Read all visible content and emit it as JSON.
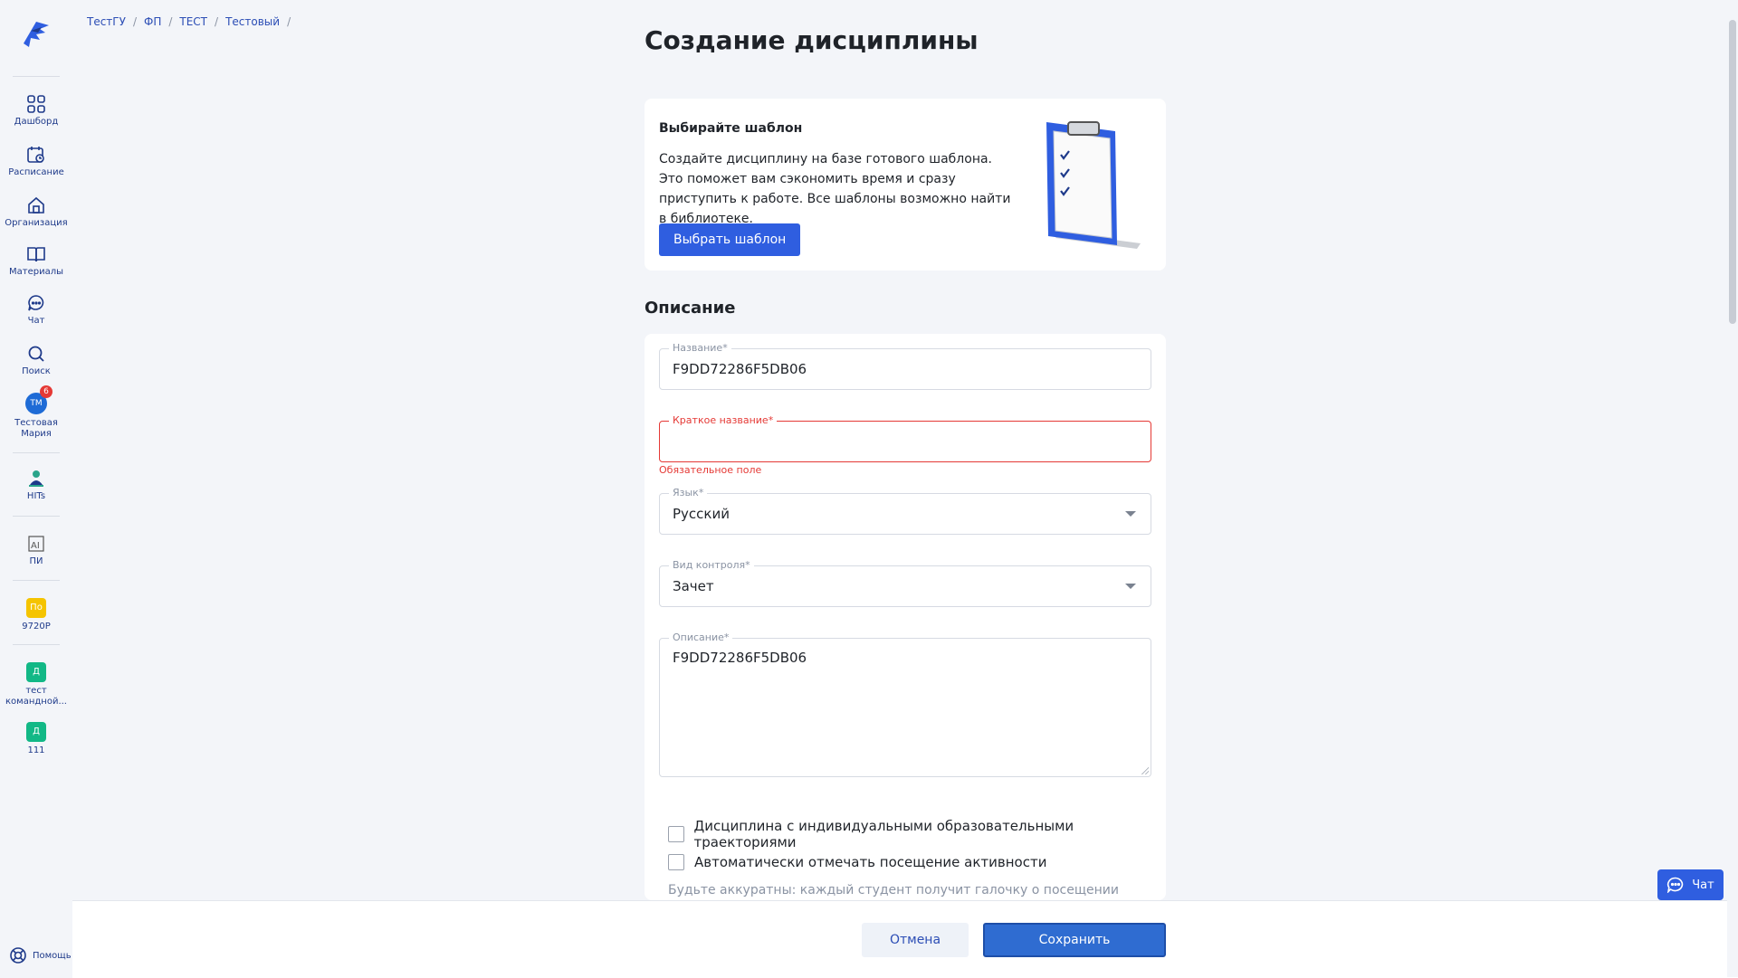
{
  "breadcrumb": [
    "ТестГУ",
    "ФП",
    "ТЕСТ",
    "Тестовый"
  ],
  "page_title": "Создание дисциплины",
  "sidebar": {
    "items": [
      {
        "label": "Дашборд",
        "icon": "dashboard-icon"
      },
      {
        "label": "Расписание",
        "icon": "calendar-icon"
      },
      {
        "label": "Организация",
        "icon": "home-icon"
      },
      {
        "label": "Материалы",
        "icon": "book-icon"
      },
      {
        "label": "Чат",
        "icon": "chat-icon"
      },
      {
        "label": "Поиск",
        "icon": "search-icon"
      }
    ],
    "user": {
      "initials": "ТМ",
      "name": "Тестовая Мария",
      "badge": "6"
    },
    "apps": [
      {
        "label": "HITs"
      },
      {
        "label": "ПИ"
      },
      {
        "label": "9720Р",
        "badge": "По",
        "color": "#f5c400"
      },
      {
        "label": "тест командной...",
        "badge": "Д",
        "color": "#12b886"
      },
      {
        "label": "111",
        "badge": "Д",
        "color": "#12b886"
      }
    ],
    "help": "Помощь"
  },
  "template_card": {
    "title": "Выбирайте шаблон",
    "text": "Создайте дисциплину на базе готового шаблона. Это поможет вам сэкономить время и сразу приступить к работе. Все шаблоны возможно найти в библиотеке.",
    "button": "Выбрать шаблон"
  },
  "description_section": {
    "title": "Описание",
    "name_label": "Название*",
    "name_value": "F9DD72286F5DB06",
    "short_label": "Краткое название*",
    "short_value": "",
    "short_error": "Обязательное поле",
    "lang_label": "Язык*",
    "lang_value": "Русский",
    "control_label": "Вид контроля*",
    "control_value": "Зачет",
    "desc_label": "Описание*",
    "desc_value": "F9DD72286F5DB06",
    "check_individual": "Дисциплина с индивидуальными образовательными траекториями",
    "check_attendance": "Автоматически отмечать посещение активности",
    "hint": "Будьте аккуратны: каждый студент получит галочку о посещении"
  },
  "footer": {
    "cancel": "Отмена",
    "save": "Сохранить"
  },
  "chat_button": "Чат",
  "colors": {
    "primary": "#2f5ee0",
    "error": "#e53935",
    "link": "#2b4db5"
  }
}
